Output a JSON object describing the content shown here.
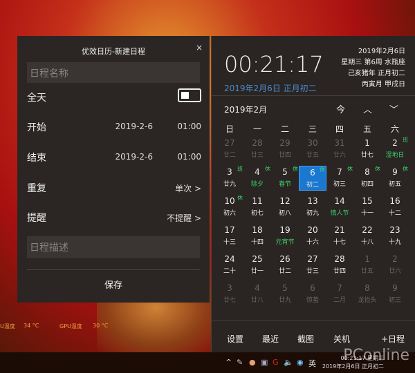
{
  "dialog": {
    "title": "优效日历-新建日程",
    "close": "×",
    "name_placeholder": "日程名称",
    "allday": "全天",
    "allday_on": false,
    "start_label": "开始",
    "start_date": "2019-2-6",
    "start_time": "01:00",
    "end_label": "结束",
    "end_date": "2019-2-6",
    "end_time": "01:00",
    "repeat_label": "重复",
    "repeat_value": "单次 >",
    "remind_label": "提醒",
    "remind_value": "不提醒 >",
    "desc_placeholder": "日程描述",
    "save": "保存"
  },
  "panel": {
    "time": "00:21:17",
    "date_lunar": "2019年2月6日 正月初二",
    "info": [
      "2019年2月6日",
      "星期三 第6周 水瓶座",
      "己亥猪年 正月初二",
      "丙寅月 甲戌日"
    ],
    "month": "2019年2月",
    "today": "今",
    "prev": "︿",
    "next": "﹀",
    "weekdays": [
      "日",
      "一",
      "二",
      "三",
      "四",
      "五",
      "六"
    ],
    "cells": [
      {
        "d": "27",
        "l": "廿二",
        "dim": true
      },
      {
        "d": "28",
        "l": "廿三",
        "dim": true
      },
      {
        "d": "29",
        "l": "廿四",
        "dim": true
      },
      {
        "d": "30",
        "l": "廿五",
        "dim": true
      },
      {
        "d": "31",
        "l": "廿六",
        "dim": true
      },
      {
        "d": "1",
        "l": "廿七"
      },
      {
        "d": "2",
        "l": "湿地日",
        "g": true,
        "b": "班"
      },
      {
        "d": "3",
        "l": "廿九",
        "b": "班"
      },
      {
        "d": "4",
        "l": "除夕",
        "g": true,
        "b": "休"
      },
      {
        "d": "5",
        "l": "春节",
        "g": true,
        "b": "休"
      },
      {
        "d": "6",
        "l": "初二",
        "b": "休",
        "sel": true
      },
      {
        "d": "7",
        "l": "初三",
        "b": "休"
      },
      {
        "d": "8",
        "l": "初四",
        "b": "休"
      },
      {
        "d": "9",
        "l": "初五",
        "b": "休"
      },
      {
        "d": "10",
        "l": "初六",
        "b": "休"
      },
      {
        "d": "11",
        "l": "初七"
      },
      {
        "d": "12",
        "l": "初八"
      },
      {
        "d": "13",
        "l": "初九"
      },
      {
        "d": "14",
        "l": "情人节",
        "g": true
      },
      {
        "d": "15",
        "l": "十一"
      },
      {
        "d": "16",
        "l": "十二"
      },
      {
        "d": "17",
        "l": "十三"
      },
      {
        "d": "18",
        "l": "十四"
      },
      {
        "d": "19",
        "l": "元宵节",
        "g": true
      },
      {
        "d": "20",
        "l": "十六"
      },
      {
        "d": "21",
        "l": "十七"
      },
      {
        "d": "22",
        "l": "十八"
      },
      {
        "d": "23",
        "l": "十九"
      },
      {
        "d": "24",
        "l": "二十"
      },
      {
        "d": "25",
        "l": "廿一"
      },
      {
        "d": "26",
        "l": "廿二"
      },
      {
        "d": "27",
        "l": "廿三"
      },
      {
        "d": "28",
        "l": "廿四"
      },
      {
        "d": "1",
        "l": "廿五",
        "dim": true
      },
      {
        "d": "2",
        "l": "廿六",
        "dim": true
      },
      {
        "d": "3",
        "l": "廿七",
        "dim": true
      },
      {
        "d": "4",
        "l": "廿八",
        "dim": true
      },
      {
        "d": "5",
        "l": "廿九",
        "dim": true
      },
      {
        "d": "6",
        "l": "惊蛰",
        "dim": true
      },
      {
        "d": "7",
        "l": "二月",
        "dim": true
      },
      {
        "d": "8",
        "l": "龙抬头",
        "dim": true
      },
      {
        "d": "9",
        "l": "初三",
        "dim": true
      }
    ],
    "footer": [
      "设置",
      "最近",
      "截图",
      "关机",
      "+日程"
    ]
  },
  "desktop": {
    "cpu_label": "U温度",
    "cpu_val": "34 °C",
    "gpu_label": "GPU温度",
    "gpu_val": "30 °C"
  },
  "taskbar": {
    "ime": "英",
    "time": "00:21:17 星期三",
    "date": "2019年2月6日 正月初二",
    "watermark": "PConline"
  },
  "colors": {
    "accent": "#1a78d0",
    "holiday": "#3ccf6a",
    "lunar_date": "#4a8acb"
  }
}
